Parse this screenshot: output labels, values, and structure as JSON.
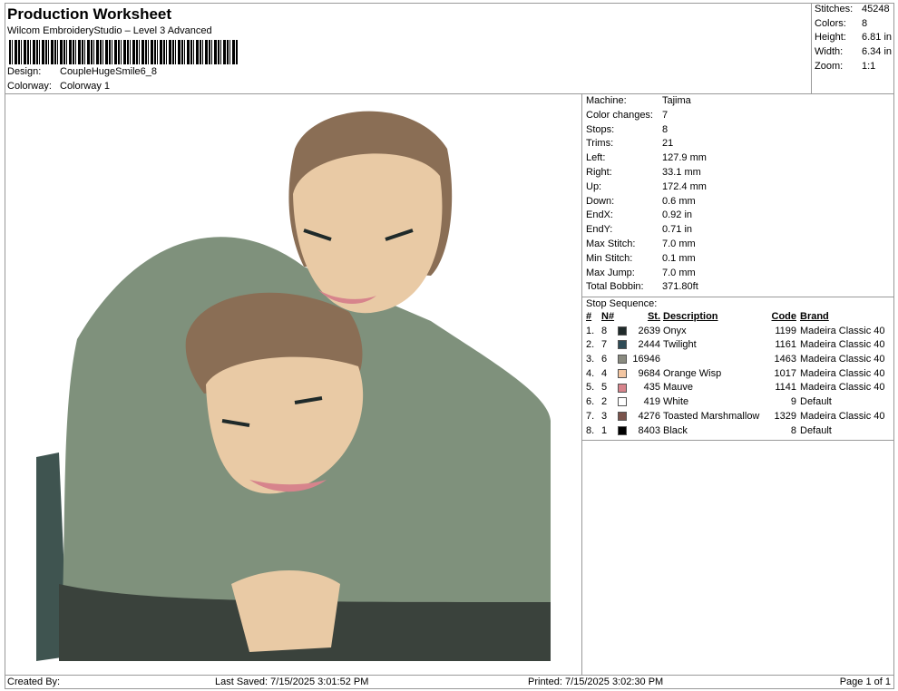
{
  "header": {
    "title": "Production Worksheet",
    "subtitle": "Wilcom EmbroideryStudio – Level 3 Advanced",
    "design_label": "Design:",
    "design": "CoupleHugeSmile6_8",
    "colorway_label": "Colorway:",
    "colorway": "Colorway 1"
  },
  "stats": [
    {
      "l": "Stitches:",
      "v": "45248"
    },
    {
      "l": "Colors:",
      "v": "8"
    },
    {
      "l": "Height:",
      "v": "6.81 in"
    },
    {
      "l": "Width:",
      "v": "6.34 in"
    },
    {
      "l": "Zoom:",
      "v": "1:1"
    }
  ],
  "machine": [
    {
      "l": "Machine:",
      "v": "Tajima"
    },
    {
      "l": "Color changes:",
      "v": "7"
    },
    {
      "l": "Stops:",
      "v": "8"
    },
    {
      "l": "Trims:",
      "v": "21"
    },
    {
      "l": "Left:",
      "v": "127.9 mm"
    },
    {
      "l": "Right:",
      "v": "33.1 mm"
    },
    {
      "l": "Up:",
      "v": "172.4 mm"
    },
    {
      "l": "Down:",
      "v": "0.6 mm"
    },
    {
      "l": "EndX:",
      "v": "0.92 in"
    },
    {
      "l": "EndY:",
      "v": "0.71 in"
    },
    {
      "l": "Max Stitch:",
      "v": "7.0 mm"
    },
    {
      "l": "Min Stitch:",
      "v": "0.1 mm"
    },
    {
      "l": "Max Jump:",
      "v": "7.0 mm"
    },
    {
      "l": "Total Bobbin:",
      "v": "371.80ft"
    }
  ],
  "sequence": {
    "title": "Stop Sequence:",
    "headers": [
      "#",
      "N#",
      "St.",
      "Description",
      "Code",
      "Brand"
    ],
    "rows": [
      {
        "i": "1.",
        "n": "8",
        "color": "#1f2a2a",
        "st": "2639",
        "desc": "Onyx",
        "code": "1199",
        "brand": "Madeira Classic 40"
      },
      {
        "i": "2.",
        "n": "7",
        "color": "#2e4b56",
        "st": "2444",
        "desc": "Twilight",
        "code": "1161",
        "brand": "Madeira Classic 40"
      },
      {
        "i": "3.",
        "n": "6",
        "color": "#8a8b80",
        "st": "16946",
        "desc": "",
        "code": "1463",
        "brand": "Madeira Classic 40"
      },
      {
        "i": "4.",
        "n": "4",
        "color": "#f3c6a2",
        "st": "9684",
        "desc": "Orange Wisp",
        "code": "1017",
        "brand": "Madeira Classic 40"
      },
      {
        "i": "5.",
        "n": "5",
        "color": "#d7848c",
        "st": "435",
        "desc": "Mauve",
        "code": "1141",
        "brand": "Madeira Classic 40"
      },
      {
        "i": "6.",
        "n": "2",
        "color": "#ffffff",
        "st": "419",
        "desc": "White",
        "code": "9",
        "brand": "Default"
      },
      {
        "i": "7.",
        "n": "3",
        "color": "#7a534b",
        "st": "4276",
        "desc": "Toasted Marshmallow",
        "code": "1329",
        "brand": "Madeira Classic 40"
      },
      {
        "i": "8.",
        "n": "1",
        "color": "#000000",
        "st": "8403",
        "desc": "Black",
        "code": "8",
        "brand": "Default"
      }
    ]
  },
  "footer": {
    "created": "Created By:",
    "saved": "Last Saved: 7/15/2025 3:01:52 PM",
    "printed": "Printed: 7/15/2025 3:02:30 PM",
    "page": "Page 1 of 1"
  }
}
